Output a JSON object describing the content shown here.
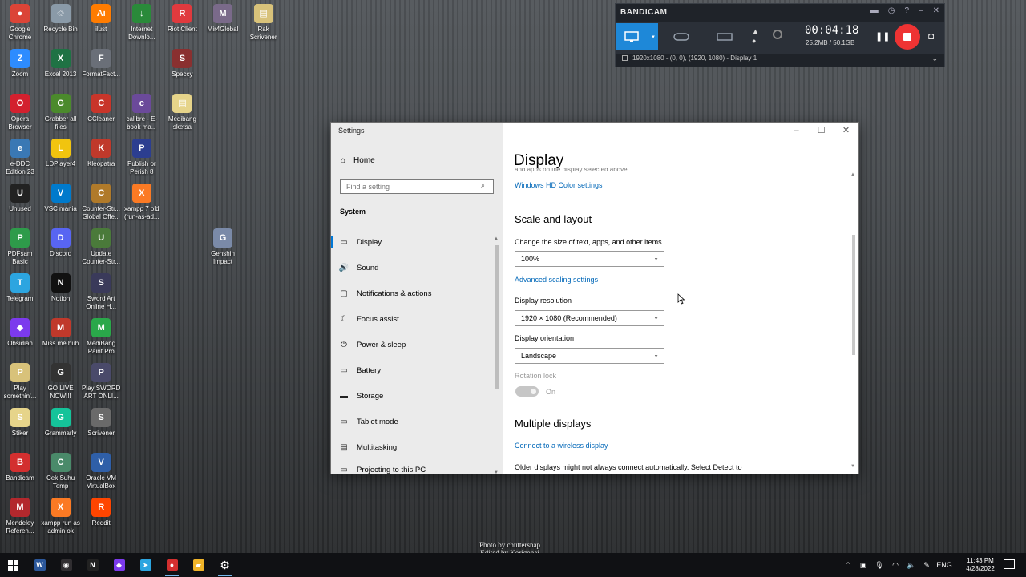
{
  "desktop": {
    "icons": [
      {
        "label": "Google Chrome",
        "glyph": "●",
        "color": "#db4437"
      },
      {
        "label": "Recycle Bin",
        "glyph": "♲",
        "color": "#8a9aa8"
      },
      {
        "label": "ilust",
        "glyph": "Ai",
        "color": "#ff7c00"
      },
      {
        "label": "Internet Downlo...",
        "glyph": "↓",
        "color": "#2a8a3a"
      },
      {
        "label": "Riot Client",
        "glyph": "R",
        "color": "#e03a3e"
      },
      {
        "label": "Mir4Global",
        "glyph": "M",
        "color": "#7a6a8a"
      },
      {
        "label": "Rak Scrivener",
        "glyph": "▤",
        "color": "#d8c27a"
      },
      {
        "label": "Zoom",
        "glyph": "Z",
        "color": "#2d8cff"
      },
      {
        "label": "Excel 2013",
        "glyph": "X",
        "color": "#1f7244"
      },
      {
        "label": "FormatFact...",
        "glyph": "F",
        "color": "#6a6f78"
      },
      {
        "label": "Speccy",
        "glyph": "S",
        "color": "#8a3030"
      },
      {
        "label": "Opera Browser",
        "glyph": "O",
        "color": "#d3202e"
      },
      {
        "label": "Grabber all files",
        "glyph": "G",
        "color": "#4b8a2c"
      },
      {
        "label": "CCleaner",
        "glyph": "C",
        "color": "#c8352a"
      },
      {
        "label": "calibre - E-book ma...",
        "glyph": "c",
        "color": "#6b4a9a"
      },
      {
        "label": "Medibang sketsa",
        "glyph": "▤",
        "color": "#e6d48a"
      },
      {
        "label": "e-DDC Edition 23",
        "glyph": "e",
        "color": "#3a78b4"
      },
      {
        "label": "LDPlayer4",
        "glyph": "L",
        "color": "#f1c40f"
      },
      {
        "label": "Kleopatra",
        "glyph": "K",
        "color": "#c0392b"
      },
      {
        "label": "Publish or Perish 8",
        "glyph": "P",
        "color": "#2c3e90"
      },
      {
        "label": "Unused",
        "glyph": "U",
        "color": "#222222"
      },
      {
        "label": "VSC mania",
        "glyph": "V",
        "color": "#007acc"
      },
      {
        "label": "Counter-Str... Global Offe...",
        "glyph": "C",
        "color": "#b07a2a"
      },
      {
        "label": "xampp 7 old (run-as-ad...",
        "glyph": "X",
        "color": "#fb7a24"
      },
      {
        "label": "PDFsam Basic",
        "glyph": "P",
        "color": "#2e9b4a"
      },
      {
        "label": "Discord",
        "glyph": "D",
        "color": "#5865f2"
      },
      {
        "label": "Update Counter-Str...",
        "glyph": "U",
        "color": "#4a7a3a"
      },
      {
        "label": "Genshin Impact",
        "glyph": "G",
        "color": "#7a8aa8"
      },
      {
        "label": "Telegram",
        "glyph": "T",
        "color": "#2ca5e0"
      },
      {
        "label": "Notion",
        "glyph": "N",
        "color": "#111111"
      },
      {
        "label": "Sword Art Online H...",
        "glyph": "S",
        "color": "#3a3a5a"
      },
      {
        "label": "Obsidian",
        "glyph": "◆",
        "color": "#7c3aed"
      },
      {
        "label": "Miss me huh",
        "glyph": "M",
        "color": "#c0392b"
      },
      {
        "label": "MediBang Paint Pro",
        "glyph": "M",
        "color": "#2aa84a"
      },
      {
        "label": "Play somethin'...",
        "glyph": "P",
        "color": "#d8c27a"
      },
      {
        "label": "GO LIVE NOW!!!",
        "glyph": "G",
        "color": "#333333"
      },
      {
        "label": "Play SWORD ART ONLI...",
        "glyph": "P",
        "color": "#4a4a6a"
      },
      {
        "label": "Stiker",
        "glyph": "S",
        "color": "#e6d48a"
      },
      {
        "label": "Grammarly",
        "glyph": "G",
        "color": "#15c39a"
      },
      {
        "label": "Scrivener",
        "glyph": "S",
        "color": "#6a6a6a"
      },
      {
        "label": "Bandicam",
        "glyph": "B",
        "color": "#d32f2f"
      },
      {
        "label": "Cek Suhu Temp",
        "glyph": "C",
        "color": "#4a8a6a"
      },
      {
        "label": "Oracle VM VirtualBox",
        "glyph": "V",
        "color": "#2f5fa8"
      },
      {
        "label": "Mendeley Referen...",
        "glyph": "M",
        "color": "#b3282d"
      },
      {
        "label": "xampp run as admin ok",
        "glyph": "X",
        "color": "#fb7a24"
      },
      {
        "label": "Reddit",
        "glyph": "R",
        "color": "#ff4500"
      }
    ],
    "photo_credit_1": "Photo by chuttersnap",
    "photo_credit_2": "Edited by Korigonai"
  },
  "bandicam": {
    "title": "BANDICAM",
    "timer": "00:04:18",
    "size": "25.2MB / 50.1GB",
    "status": "1920x1080 - (0, 0), (1920, 1080) - Display 1"
  },
  "settings": {
    "window_title": "Settings",
    "home_label": "Home",
    "search_placeholder": "Find a setting",
    "category": "System",
    "nav": [
      {
        "label": "Display",
        "icon": "▭"
      },
      {
        "label": "Sound",
        "icon": "🔊"
      },
      {
        "label": "Notifications & actions",
        "icon": "▢"
      },
      {
        "label": "Focus assist",
        "icon": "☾"
      },
      {
        "label": "Power & sleep",
        "icon": "⏻"
      },
      {
        "label": "Battery",
        "icon": "▭"
      },
      {
        "label": "Storage",
        "icon": "▬"
      },
      {
        "label": "Tablet mode",
        "icon": "▭"
      },
      {
        "label": "Multitasking",
        "icon": "▤"
      },
      {
        "label": "Projecting to this PC",
        "icon": "▭"
      }
    ],
    "page_title": "Display",
    "clipped_text": "and apps on the display selected above.",
    "hdr_link": "Windows HD Color settings",
    "scale_heading": "Scale and layout",
    "scale_label": "Change the size of text, apps, and other items",
    "scale_value": "100%",
    "advanced_scaling_link": "Advanced scaling settings",
    "resolution_label": "Display resolution",
    "resolution_value": "1920 × 1080 (Recommended)",
    "orientation_label": "Display orientation",
    "orientation_value": "Landscape",
    "rotation_lock_label": "Rotation lock",
    "rotation_lock_state": "On",
    "multiple_heading": "Multiple displays",
    "wireless_link": "Connect to a wireless display",
    "older_text": "Older displays might not always connect automatically. Select Detect to"
  },
  "taskbar": {
    "apps": [
      {
        "name": "word",
        "glyph": "W",
        "color": "#2b579a"
      },
      {
        "name": "obs",
        "glyph": "◉",
        "color": "#302e31"
      },
      {
        "name": "notion",
        "glyph": "N",
        "color": "#222"
      },
      {
        "name": "obsidian",
        "glyph": "◆",
        "color": "#7c3aed"
      },
      {
        "name": "telegram",
        "glyph": "➤",
        "color": "#2ca5e0"
      },
      {
        "name": "bandicam",
        "glyph": "●",
        "color": "#d32f2f"
      },
      {
        "name": "file-explorer",
        "glyph": "▰",
        "color": "#f0b429"
      },
      {
        "name": "settings",
        "glyph": "⚙",
        "color": "#101114"
      }
    ],
    "lang": "ENG",
    "time": "11:43 PM",
    "date": "4/28/2022"
  }
}
